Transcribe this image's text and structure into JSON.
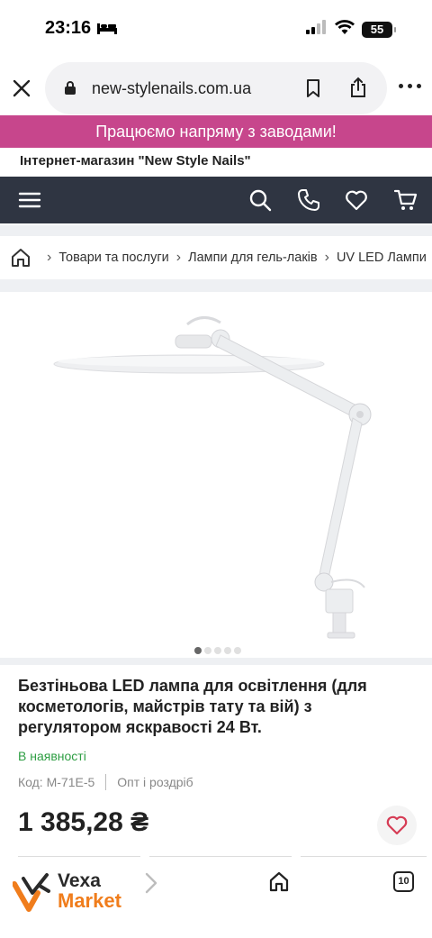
{
  "status_bar": {
    "time": "23:16",
    "battery": "55"
  },
  "browser": {
    "url": "new-stylenails.com.ua"
  },
  "promo": {
    "text": "Працюємо напряму з заводами!"
  },
  "shop": {
    "title": "Інтернет-магазин \"New Style Nails\""
  },
  "breadcrumb": {
    "items": [
      "Товари та послуги",
      "Лампи для гель-лаків",
      "UV LED Лампи"
    ]
  },
  "carousel": {
    "total": 5,
    "active": 1
  },
  "product": {
    "title": "Безтіньова LED лампа для освітлення (для косметологів, майстрів тату та вій) з регулятором яскравості 24 Вт.",
    "stock": "В наявності",
    "code": "Код: M-71E-5",
    "sale_type": "Опт і роздріб",
    "price": "1 385,28 ₴"
  },
  "bottom_bar": {
    "logo_top": "Vexa",
    "logo_bottom": "Market",
    "tabs_count": "10"
  },
  "colors": {
    "promo_bg": "#c7468c",
    "nav_bg": "#2f3542",
    "stock_green": "#2e9e43",
    "logo_orange": "#f07d1c",
    "fav_red": "#d63c55"
  }
}
